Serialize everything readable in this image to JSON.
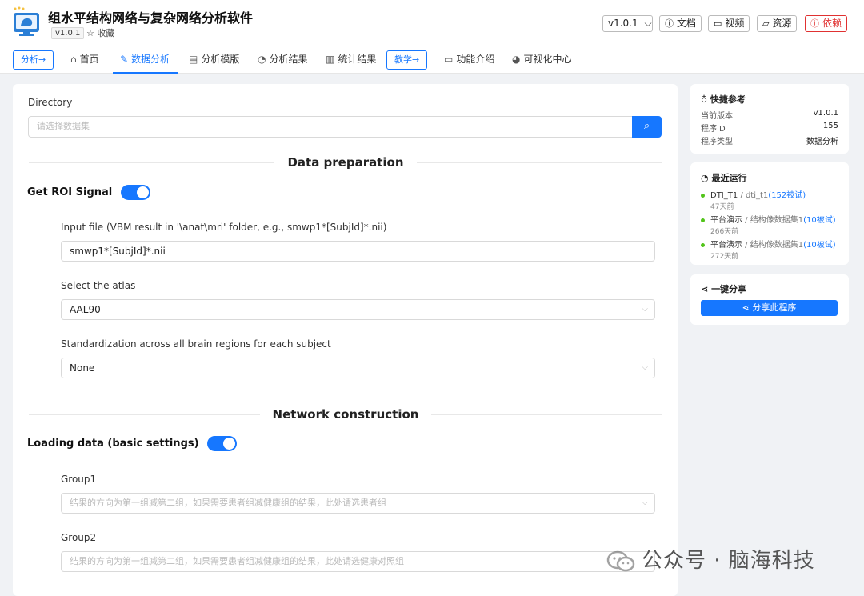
{
  "app": {
    "title": "组水平结构网络与复杂网络分析软件",
    "version_tag": "v1.0.1",
    "favorite_label": "收藏"
  },
  "header_buttons": {
    "version": "v1.0.1",
    "docs": "文档",
    "video": "视频",
    "resources": "资源",
    "dependencies": "依赖"
  },
  "nav": {
    "analyze_btn": "分析→",
    "home": "首页",
    "data_analysis": "数据分析",
    "templates": "分析模版",
    "results": "分析结果",
    "stats": "统计结果",
    "teach_btn": "教学→",
    "features": "功能介绍",
    "viz_center": "可视化中心"
  },
  "form": {
    "directory_label": "Directory",
    "directory_placeholder": "请选择数据集",
    "section_prep": "Data preparation",
    "roi_label": "Get ROI Signal",
    "input_file_label": "Input file (VBM result in '\\anat\\mri' folder, e.g., smwp1*[SubjId]*.nii)",
    "input_file_value": "smwp1*[SubjId]*.nii",
    "atlas_label": "Select the atlas",
    "atlas_value": "AAL90",
    "standardization_label": "Standardization across all brain regions for each subject",
    "standardization_value": "None",
    "section_network": "Network construction",
    "loading_label": "Loading data (basic settings)",
    "group1_label": "Group1",
    "group1_placeholder": "结果的方向为第一组减第二组，如果需要患者组减健康组的结果，此处请选患者组",
    "group2_label": "Group2",
    "group2_placeholder": "结果的方向为第一组减第二组，如果需要患者组减健康组的结果，此处请选健康对照组"
  },
  "quick_ref": {
    "title": "快捷参考",
    "rows": [
      {
        "k": "当前版本",
        "v": "v1.0.1"
      },
      {
        "k": "程序ID",
        "v": "155"
      },
      {
        "k": "程序类型",
        "v": "数据分析"
      }
    ]
  },
  "recent": {
    "title": "最近运行",
    "items": [
      {
        "name": "DTI_T1",
        "sub": " / dti_t1",
        "link": "(152被试)",
        "ago": "47天前"
      },
      {
        "name": "平台演示",
        "sub": " / 结构像数据集1",
        "link": "(10被试)",
        "ago": "266天前"
      },
      {
        "name": "平台演示",
        "sub": " / 结构像数据集1",
        "link": "(10被试)",
        "ago": "272天前"
      }
    ]
  },
  "share": {
    "title": "一键分享",
    "button": "分享此程序"
  },
  "watermark": "公众号 · 脑海科技",
  "colors": {
    "accent": "#1677ff",
    "danger": "#e03131",
    "success": "#52c41a"
  },
  "icons": [
    "logo-icon",
    "star-icon",
    "question-icon",
    "video-icon",
    "folder-icon",
    "alert-icon",
    "home-icon",
    "edit-icon",
    "file-icon",
    "clock-icon",
    "bar-chart-icon",
    "monitor-icon",
    "pie-icon",
    "search-icon",
    "bulb-icon",
    "share-icon",
    "wechat-icon"
  ]
}
